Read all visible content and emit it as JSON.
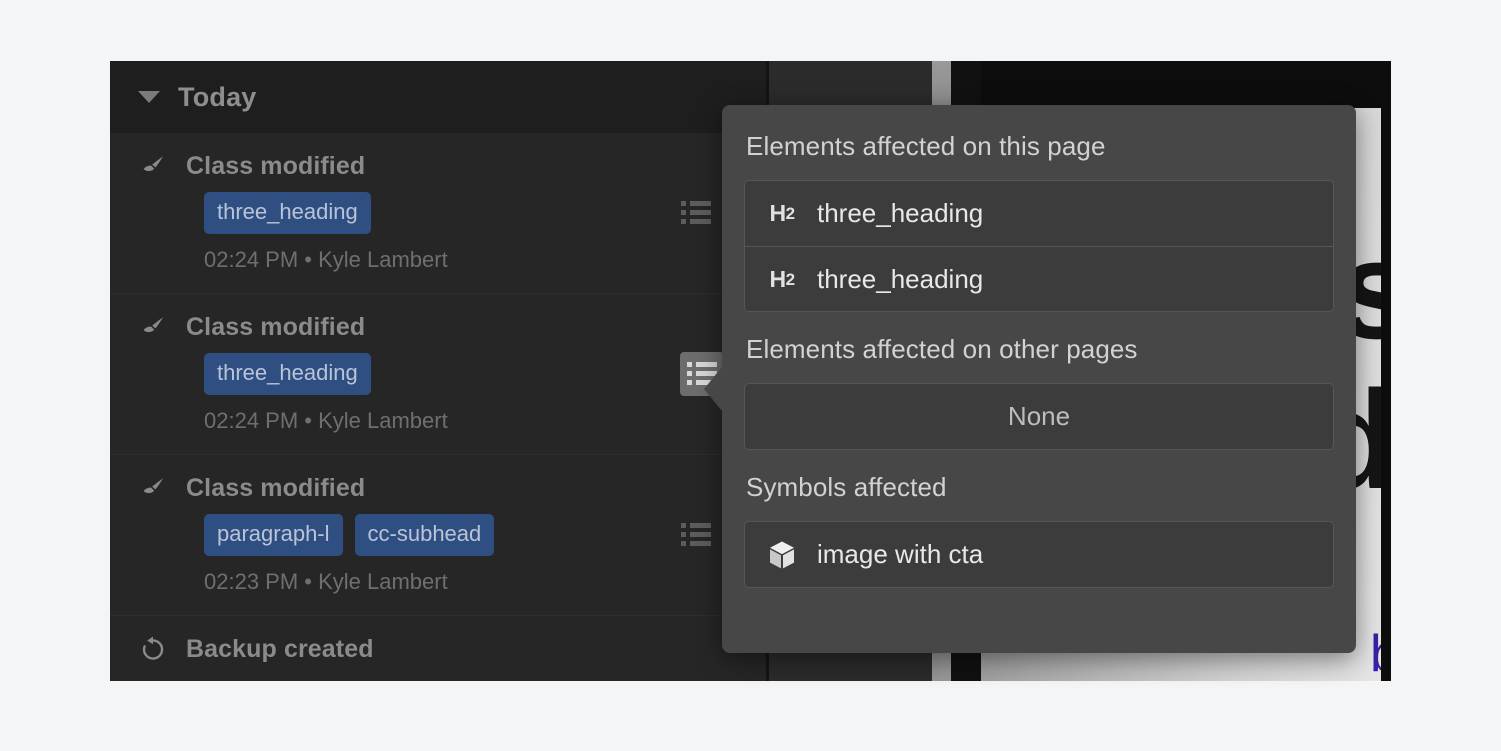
{
  "canvas": {
    "word_1": "is",
    "word_2": "d",
    "word_3": "b"
  },
  "activity_panel": {
    "header": {
      "title": "Today",
      "caret_icon": "caret-down-icon"
    },
    "rows": [
      {
        "icon": "paintbrush-icon",
        "title": "Class modified",
        "tags": [
          "three_heading"
        ],
        "meta": "02:24 PM • Kyle Lambert",
        "action_icon": "list-details-icon",
        "action_active": false
      },
      {
        "icon": "paintbrush-icon",
        "title": "Class modified",
        "tags": [
          "three_heading"
        ],
        "meta": "02:24 PM • Kyle Lambert",
        "action_icon": "list-details-icon",
        "action_active": true
      },
      {
        "icon": "paintbrush-icon",
        "title": "Class modified",
        "tags": [
          "paragraph-l",
          "cc-subhead"
        ],
        "meta": "02:23 PM • Kyle Lambert",
        "action_icon": "list-details-icon",
        "action_active": false
      },
      {
        "icon": "restore-icon",
        "title": "Backup created",
        "tags": [],
        "meta": "",
        "action_icon": "",
        "action_active": false
      }
    ]
  },
  "popover": {
    "sections": [
      {
        "title": "Elements affected on this page",
        "type": "list",
        "items": [
          {
            "badge": "H2",
            "label": "three_heading",
            "icon": "heading-2-badge"
          },
          {
            "badge": "H2",
            "label": "three_heading",
            "icon": "heading-2-badge"
          }
        ]
      },
      {
        "title": "Elements affected on other pages",
        "type": "empty",
        "empty_label": "None"
      },
      {
        "title": "Symbols affected",
        "type": "symbols",
        "items": [
          {
            "label": "image with cta",
            "icon": "cube-symbol-icon"
          }
        ]
      }
    ]
  },
  "colors": {
    "panel_bg": "#252525",
    "panel_header_bg": "#1e1e1e",
    "popover_bg": "#474747",
    "popover_list_bg": "#3c3c3c",
    "tag_bg": "#2f4f83",
    "tag_text": "#b9c4d6",
    "accent_link": "#3b1fa6"
  }
}
